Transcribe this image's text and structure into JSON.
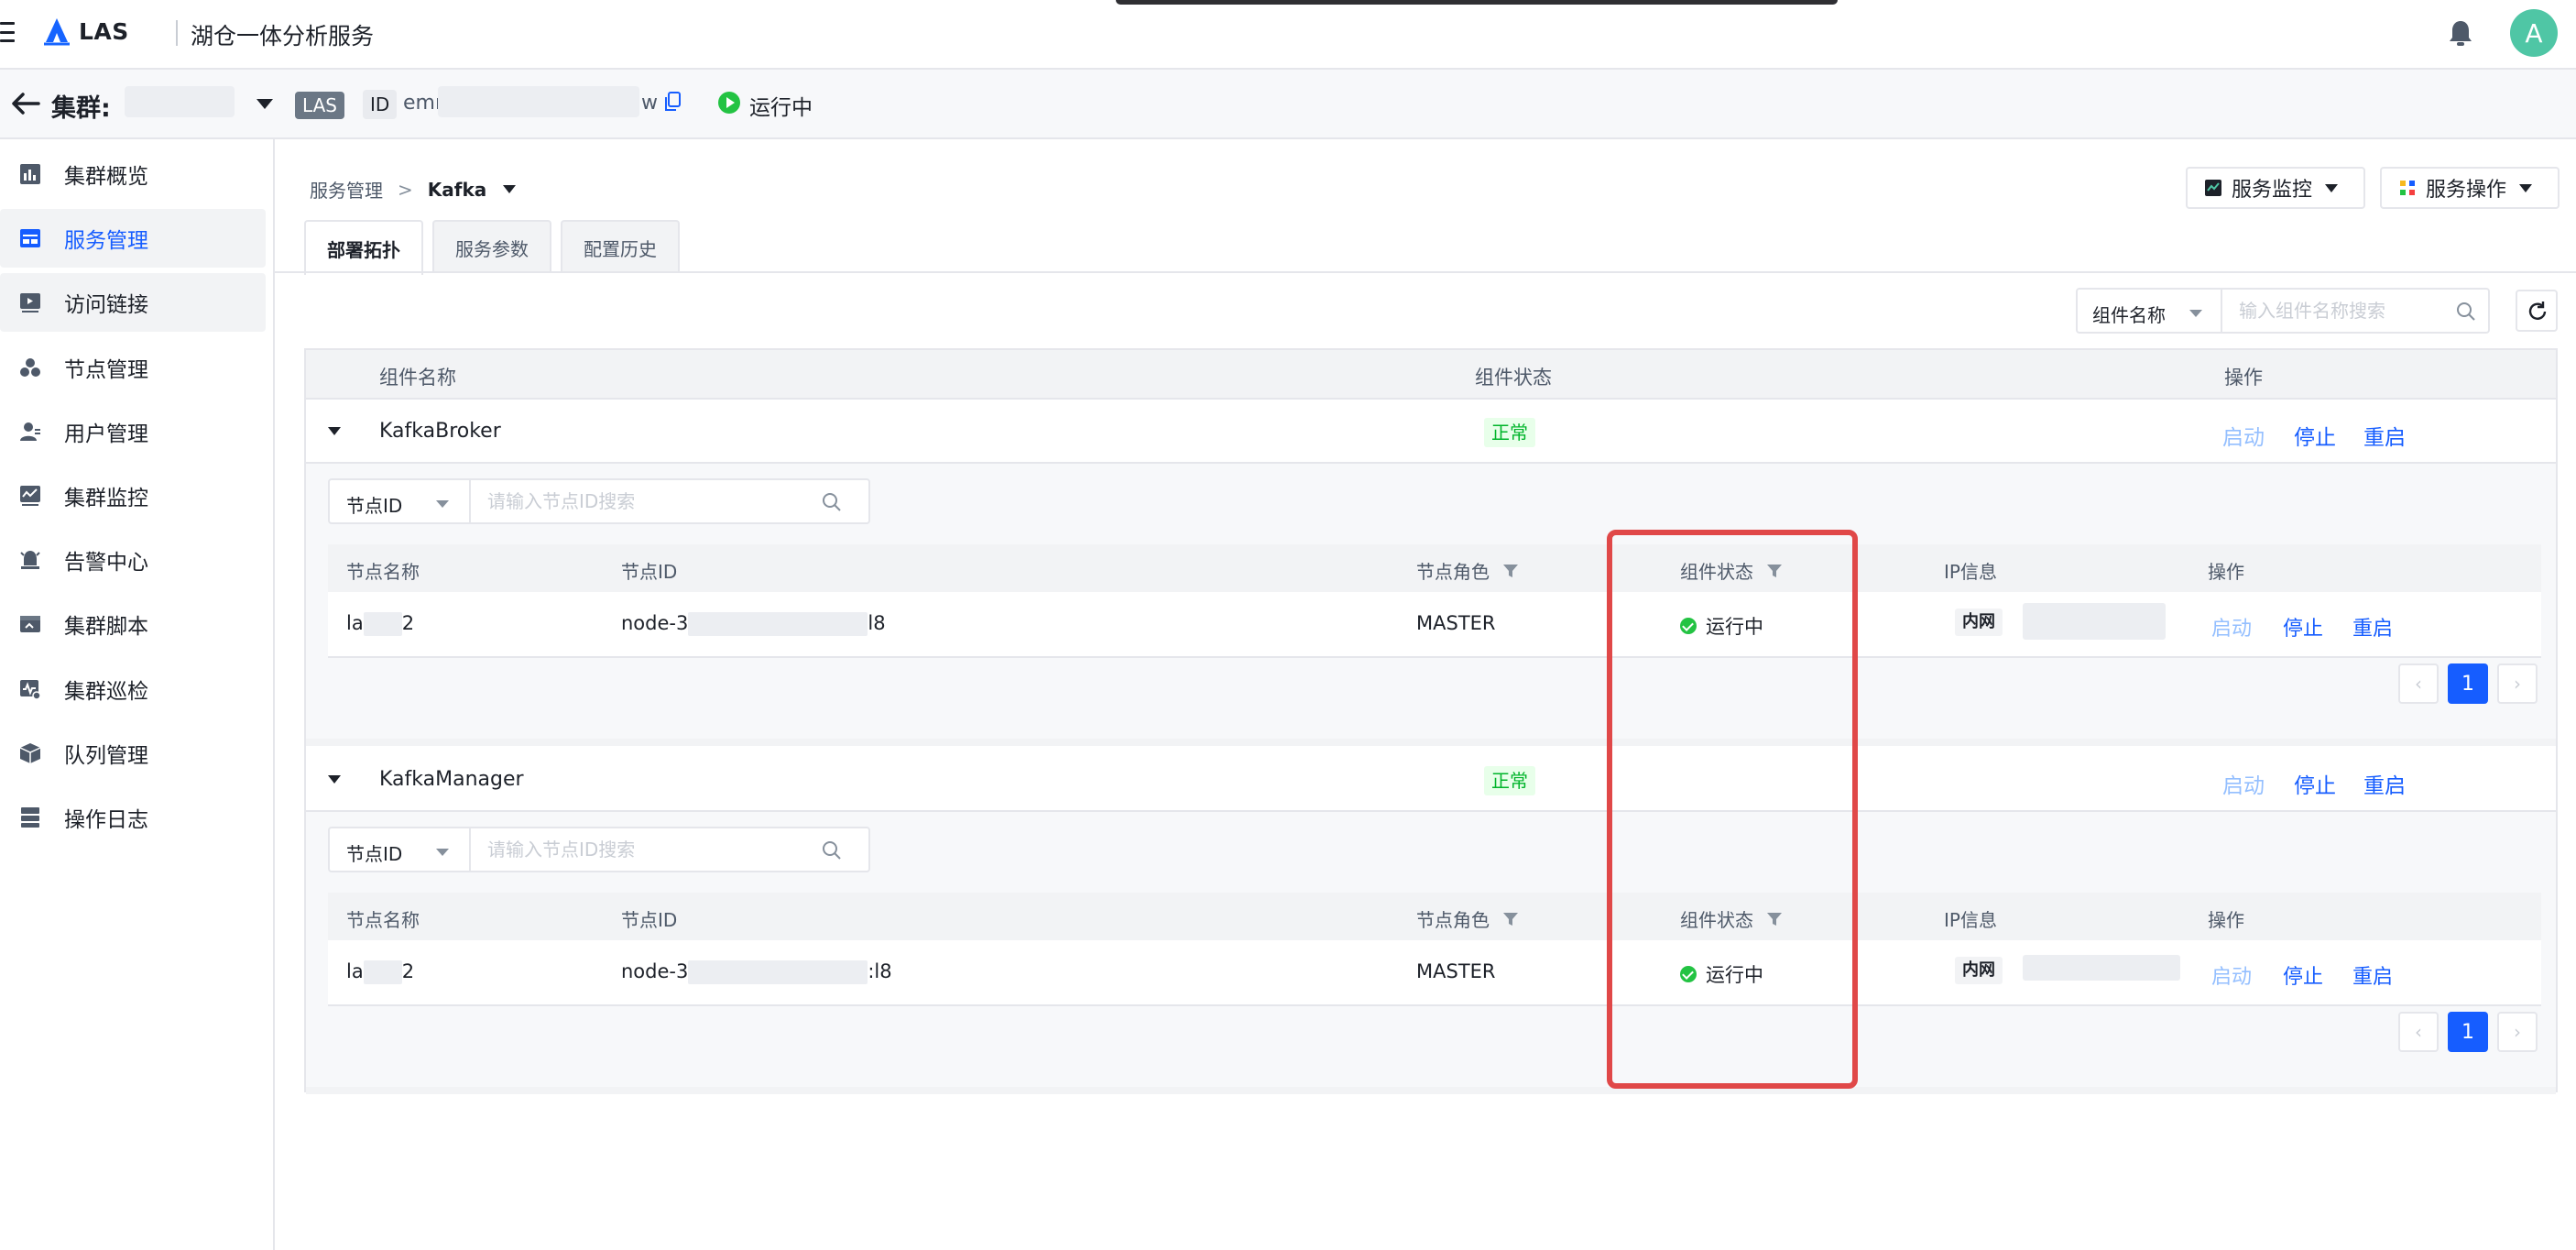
{
  "topbar": {
    "brand": "LAS",
    "product": "湖仓一体分析服务",
    "avatar_letter": "A",
    "icons": [
      "menu-icon",
      "las-logo",
      "bell-icon"
    ]
  },
  "cluster_bar": {
    "label": "集群:",
    "type_tag": "LAS",
    "id_label": "ID",
    "id_prefix": "emr",
    "id_suffix": "w",
    "status": "运行中"
  },
  "sidebar": {
    "items": [
      {
        "label": "集群概览",
        "icon": "chart-icon"
      },
      {
        "label": "服务管理",
        "icon": "service-icon",
        "active": true
      },
      {
        "label": "访问链接",
        "icon": "link-icon",
        "hover": true
      },
      {
        "label": "节点管理",
        "icon": "nodes-icon"
      },
      {
        "label": "用户管理",
        "icon": "user-icon"
      },
      {
        "label": "集群监控",
        "icon": "monitor-icon"
      },
      {
        "label": "告警中心",
        "icon": "alarm-icon"
      },
      {
        "label": "集群脚本",
        "icon": "script-icon"
      },
      {
        "label": "集群巡检",
        "icon": "inspect-icon"
      },
      {
        "label": "队列管理",
        "icon": "queue-icon"
      },
      {
        "label": "操作日志",
        "icon": "log-icon"
      }
    ]
  },
  "breadcrumb": {
    "parent": "服务管理",
    "separator": ">",
    "current": "Kafka"
  },
  "actions": {
    "monitor": "服务监控",
    "operate": "服务操作"
  },
  "tabs": [
    "部署拓扑",
    "服务参数",
    "配置历史"
  ],
  "component_filter": {
    "select": "组件名称",
    "placeholder": "输入组件名称搜索"
  },
  "main_table": {
    "headers": [
      "组件名称",
      "组件状态",
      "操作"
    ],
    "groups": [
      {
        "name": "KafkaBroker",
        "status": "正常",
        "actions": [
          "启动",
          "停止",
          "重启"
        ],
        "node_filter": {
          "select": "节点ID",
          "placeholder": "请输入节点ID搜索"
        },
        "node_headers": [
          "节点名称",
          "节点ID",
          "节点角色",
          "组件状态",
          "IP信息",
          "操作"
        ],
        "nodes": [
          {
            "name_prefix": "la",
            "name_suffix": "2",
            "id_prefix": "node-3",
            "id_suffix": "l8",
            "role": "MASTER",
            "status": "运行中",
            "net": "内网",
            "actions": [
              "启动",
              "停止",
              "重启"
            ]
          }
        ],
        "page": "1"
      },
      {
        "name": "KafkaManager",
        "status": "正常",
        "actions": [
          "启动",
          "停止",
          "重启"
        ],
        "node_filter": {
          "select": "节点ID",
          "placeholder": "请输入节点ID搜索"
        },
        "node_headers": [
          "节点名称",
          "节点ID",
          "节点角色",
          "组件状态",
          "IP信息",
          "操作"
        ],
        "nodes": [
          {
            "name_prefix": "la",
            "name_suffix": "2",
            "id_prefix": "node-3",
            "id_suffix": ":l8",
            "role": "MASTER",
            "status": "运行中",
            "net": "内网",
            "actions": [
              "启动",
              "停止",
              "重启"
            ]
          }
        ],
        "page": "1"
      }
    ]
  },
  "pager": {
    "prev": "‹",
    "next": "›"
  },
  "colors": {
    "primary": "#165dff",
    "success": "#00b42a",
    "highlight": "#e04848",
    "avatar": "#4fc6a5"
  }
}
